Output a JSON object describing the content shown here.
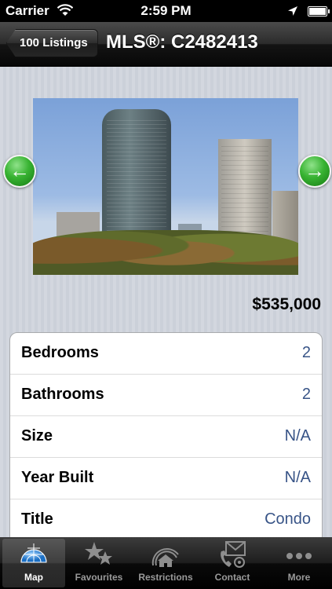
{
  "status_bar": {
    "carrier": "Carrier",
    "time": "2:59 PM"
  },
  "nav": {
    "back_label": "100 Listings",
    "title": "MLS®: C2482413"
  },
  "photo": {
    "prev_icon": "arrow-left-icon",
    "next_icon": "arrow-right-icon"
  },
  "price": "$535,000",
  "details": [
    {
      "label": "Bedrooms",
      "value": "2"
    },
    {
      "label": "Bathrooms",
      "value": "2"
    },
    {
      "label": "Size",
      "value": "N/A"
    },
    {
      "label": "Year Built",
      "value": "N/A"
    },
    {
      "label": "Title",
      "value": "Condo"
    }
  ],
  "tabs": [
    {
      "label": "Map",
      "icon": "globe-icon",
      "active": true
    },
    {
      "label": "Favourites",
      "icon": "stars-icon",
      "active": false
    },
    {
      "label": "Restrictions",
      "icon": "house-icon",
      "active": false
    },
    {
      "label": "Contact",
      "icon": "contact-icon",
      "active": false
    },
    {
      "label": "More",
      "icon": "more-icon",
      "active": false
    }
  ],
  "colors": {
    "value_text": "#385487",
    "arrow_green": "#38b332"
  }
}
